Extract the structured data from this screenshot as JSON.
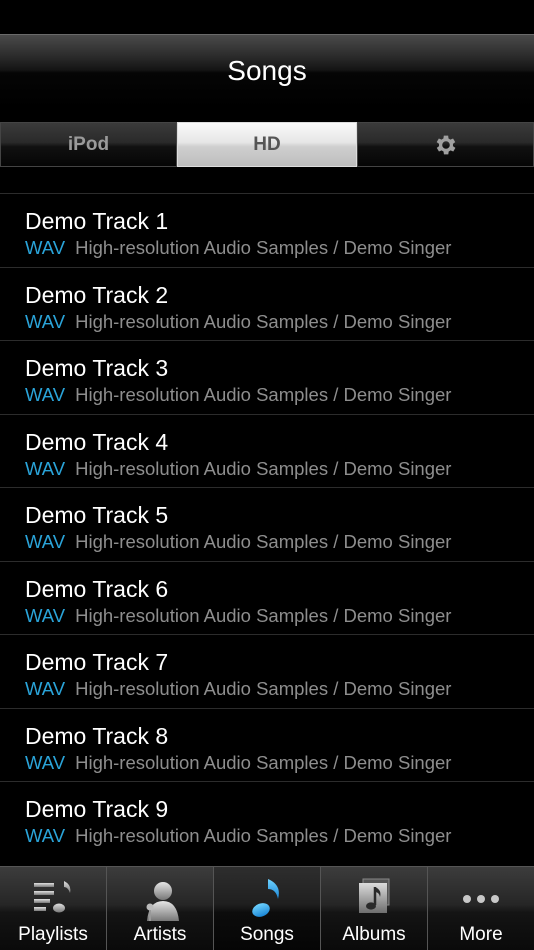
{
  "header": {
    "title": "Songs"
  },
  "segments": [
    {
      "label": "iPod",
      "active": false
    },
    {
      "label": "HD",
      "active": true
    },
    {
      "label": "",
      "icon": "gear-icon",
      "active": false
    }
  ],
  "songs": [
    {
      "title": "Demo Track 1",
      "format": "WAV",
      "subtitle": "High-resolution Audio Samples / Demo Singer"
    },
    {
      "title": "Demo Track 2",
      "format": "WAV",
      "subtitle": "High-resolution Audio Samples / Demo Singer"
    },
    {
      "title": "Demo Track 3",
      "format": "WAV",
      "subtitle": "High-resolution Audio Samples / Demo Singer"
    },
    {
      "title": "Demo Track 4",
      "format": "WAV",
      "subtitle": "High-resolution Audio Samples / Demo Singer"
    },
    {
      "title": "Demo Track 5",
      "format": "WAV",
      "subtitle": "High-resolution Audio Samples / Demo Singer"
    },
    {
      "title": "Demo Track 6",
      "format": "WAV",
      "subtitle": "High-resolution Audio Samples / Demo Singer"
    },
    {
      "title": "Demo Track 7",
      "format": "WAV",
      "subtitle": "High-resolution Audio Samples / Demo Singer"
    },
    {
      "title": "Demo Track 8",
      "format": "WAV",
      "subtitle": "High-resolution Audio Samples / Demo Singer"
    },
    {
      "title": "Demo Track 9",
      "format": "WAV",
      "subtitle": "High-resolution Audio Samples / Demo Singer"
    }
  ],
  "tabs": [
    {
      "label": "Playlists",
      "icon": "playlists-icon",
      "active": false
    },
    {
      "label": "Artists",
      "icon": "artists-icon",
      "active": false
    },
    {
      "label": "Songs",
      "icon": "music-note-icon",
      "active": true
    },
    {
      "label": "Albums",
      "icon": "albums-icon",
      "active": false
    },
    {
      "label": "More",
      "icon": "more-icon",
      "active": false
    }
  ],
  "colors": {
    "accent": "#2aa4d9",
    "format_label": "#2aa4d9",
    "subtitle": "#8e8e8e",
    "background": "#000000"
  }
}
